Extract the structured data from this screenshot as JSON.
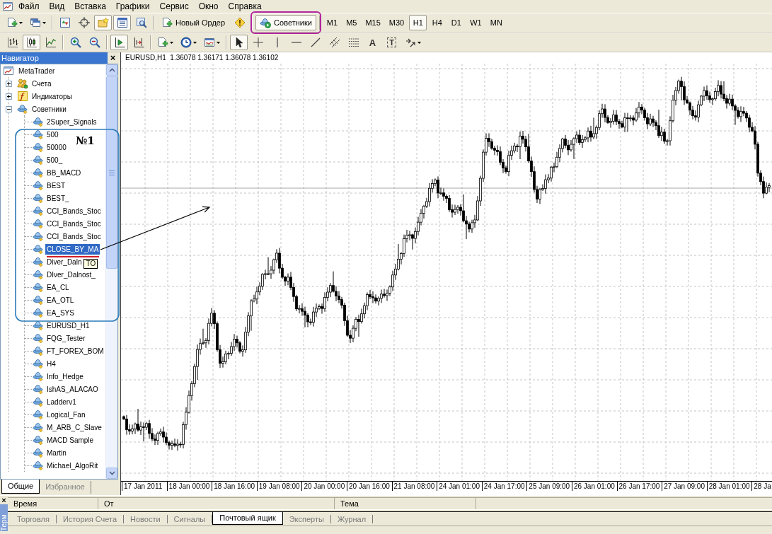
{
  "menu_bar": {
    "items": [
      "Файл",
      "Вид",
      "Вставка",
      "Графики",
      "Сервис",
      "Окно",
      "Справка"
    ]
  },
  "toolbars": [
    {
      "groups": [
        [
          {
            "kind": "menu",
            "pressed": false
          },
          {
            "kind": "menu",
            "pressed": false
          }
        ],
        [
          {
            "kind": "icon",
            "pressed": false
          },
          {
            "kind": "icon",
            "pressed": false
          },
          {
            "kind": "icon",
            "pressed": true
          },
          {
            "kind": "icon",
            "pressed": true
          },
          {
            "kind": "icon",
            "pressed": false
          }
        ],
        [
          {
            "kind": "text",
            "label": "Новый Ордер",
            "pressed": false
          },
          {
            "kind": "icon",
            "pressed": false
          }
        ],
        [
          {
            "kind": "text",
            "label": "Советники",
            "pressed": true,
            "highlighted": true
          }
        ],
        [
          {
            "kind": "period",
            "label": "M1",
            "selected": false
          },
          {
            "kind": "period",
            "label": "M5",
            "selected": false
          },
          {
            "kind": "period",
            "label": "M15",
            "selected": false
          },
          {
            "kind": "period",
            "label": "M30",
            "selected": false
          },
          {
            "kind": "period",
            "label": "H1",
            "selected": true
          },
          {
            "kind": "period",
            "label": "H4",
            "selected": false
          },
          {
            "kind": "period",
            "label": "D1",
            "selected": false
          },
          {
            "kind": "period",
            "label": "W1",
            "selected": false
          },
          {
            "kind": "period",
            "label": "MN",
            "selected": false
          }
        ]
      ]
    },
    {
      "groups": [
        [
          {
            "kind": "icon",
            "pressed": false
          },
          {
            "kind": "icon",
            "pressed": true
          },
          {
            "kind": "icon",
            "pressed": false
          }
        ],
        [
          {
            "kind": "icon",
            "pressed": false
          },
          {
            "kind": "icon",
            "pressed": false
          }
        ],
        [
          {
            "kind": "icon",
            "pressed": true
          },
          {
            "kind": "icon",
            "pressed": false
          }
        ],
        [
          {
            "kind": "menu",
            "pressed": false
          },
          {
            "kind": "menu",
            "pressed": false
          },
          {
            "kind": "menu",
            "pressed": false
          }
        ],
        [
          {
            "kind": "icon",
            "pressed": true
          },
          {
            "kind": "icon",
            "pressed": false
          },
          {
            "kind": "icon",
            "pressed": false
          },
          {
            "kind": "icon",
            "pressed": false
          },
          {
            "kind": "icon",
            "pressed": false
          },
          {
            "kind": "icon",
            "pressed": false
          },
          {
            "kind": "icon",
            "pressed": false
          },
          {
            "kind": "glyph",
            "glyph": "A",
            "pressed": false
          },
          {
            "kind": "glyph_box",
            "glyph": "T",
            "pressed": false
          },
          {
            "kind": "menu",
            "pressed": false
          }
        ]
      ]
    }
  ],
  "navigator": {
    "title": "Навигатор",
    "close_glyph": "×",
    "tree": {
      "label": "MetaTrader",
      "selected": false,
      "children": [
        {
          "kind": "accounts",
          "label": "Счета",
          "expanded": false,
          "selected": false
        },
        {
          "kind": "indicators",
          "label": "Индикаторы",
          "expanded": false,
          "selected": false
        },
        {
          "kind": "experts",
          "label": "Советники",
          "expanded": true,
          "selected": false,
          "children": [
            {
              "label": "2Super_Signals",
              "selected": false
            },
            {
              "label": "500",
              "selected": false
            },
            {
              "label": "50000",
              "selected": false
            },
            {
              "label": "500_",
              "selected": false
            },
            {
              "label": "BB_MACD",
              "selected": false
            },
            {
              "label": "BEST",
              "selected": false
            },
            {
              "label": "BEST_",
              "selected": false
            },
            {
              "label": "CCI_Bands_Stoc",
              "selected": false
            },
            {
              "label": "CCI_Bands_Stoc",
              "selected": false
            },
            {
              "label": "CCI_Bands_Stoc",
              "selected": false
            },
            {
              "label": "CLOSE_BY_MA",
              "selected": true
            },
            {
              "label": "Diver_Daln",
              "selected": false,
              "tooltip": "TO"
            },
            {
              "label": "DIver_Dalnost_",
              "selected": false
            },
            {
              "label": "EA_CL",
              "selected": false
            },
            {
              "label": "EA_OTL",
              "selected": false
            },
            {
              "label": "EA_SYS",
              "selected": false
            },
            {
              "label": "EURUSD_H1",
              "selected": false
            },
            {
              "label": "FQG_Tester",
              "selected": false
            },
            {
              "label": "FT_FOREX_BOM",
              "selected": false
            },
            {
              "label": "H4",
              "selected": false
            },
            {
              "label": "Info_Hedge",
              "selected": false
            },
            {
              "label": "IshAS_ALACAO",
              "selected": false
            },
            {
              "label": "Ladderv1",
              "selected": false
            },
            {
              "label": "Logical_Fan",
              "selected": false
            },
            {
              "label": "M_ARB_C_Slave",
              "selected": false
            },
            {
              "label": "MACD Sample",
              "selected": false
            },
            {
              "label": "Martin",
              "selected": false
            },
            {
              "label": "Michael_AlgoRit",
              "selected": false
            }
          ]
        }
      ]
    },
    "tabs": [
      {
        "label": "Общие",
        "selected": true
      },
      {
        "label": "Избранное",
        "selected": false
      }
    ]
  },
  "annotation": {
    "label": "№1"
  },
  "chart": {
    "title": "EURUSD,H1  1.36078 1.36171 1.36078 1.36102",
    "time_labels": [
      "17 Jan 2011",
      "18 Jan 00:00",
      "18 Jan 16:00",
      "19 Jan 08:00",
      "20 Jan 00:00",
      "20 Jan 16:00",
      "21 Jan 08:00",
      "24 Jan 01:00",
      "24 Jan 17:00",
      "25 Jan 09:00",
      "26 Jan 01:00",
      "26 Jan 17:00",
      "27 Jan 09:00",
      "28 Jan 01:00",
      "28 Ja"
    ]
  },
  "terminal": {
    "close_glyph": "×",
    "side_label": "Терм",
    "columns": [
      "Время",
      "От",
      "Тема"
    ],
    "tabs": [
      {
        "label": "Торговля",
        "selected": false
      },
      {
        "label": "История Счета",
        "selected": false
      },
      {
        "label": "Новости",
        "selected": false
      },
      {
        "label": "Сигналы",
        "selected": false
      },
      {
        "label": "Почтовый ящик",
        "selected": true
      },
      {
        "label": "Эксперты",
        "selected": false
      },
      {
        "label": "Журнал",
        "selected": false
      }
    ]
  }
}
